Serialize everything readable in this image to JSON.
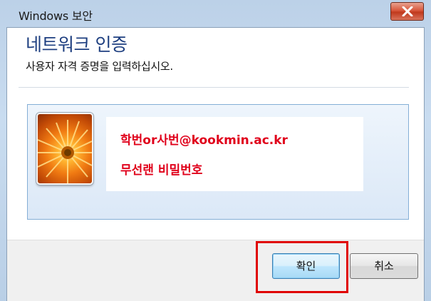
{
  "window": {
    "title": "Windows 보안"
  },
  "dialog": {
    "heading": "네트워크 인증",
    "subheading": "사용자 자격 증명을 입력하십시오."
  },
  "credential": {
    "username_hint": "학번or사번@kookmin.ac.kr",
    "password_hint": "무선랜 비밀번호"
  },
  "buttons": {
    "ok_label": "확인",
    "cancel_label": "취소"
  },
  "icons": {
    "close": "close-icon",
    "avatar": "user-avatar-flower-icon"
  },
  "colors": {
    "heading": "#1e3f80",
    "hint_text": "#e0001b",
    "highlight_border": "#e00000",
    "close_button": "#c0391d"
  }
}
